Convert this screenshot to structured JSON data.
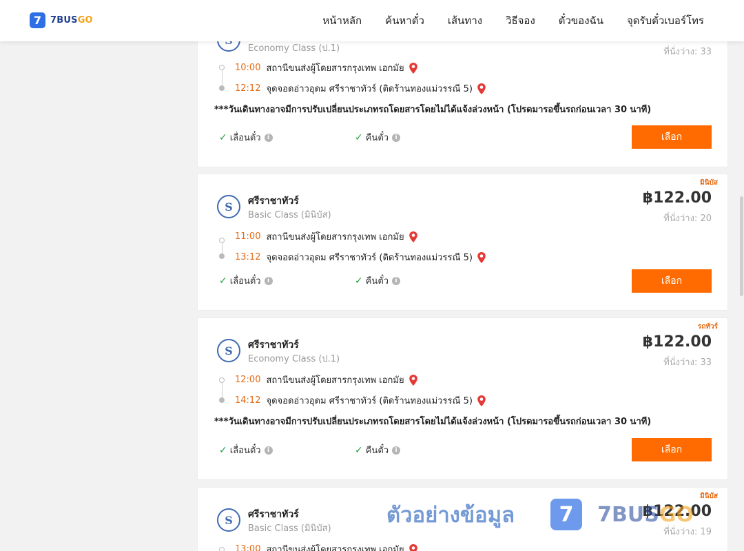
{
  "header": {
    "logo_mark": "7",
    "logo_brand": "7BUS",
    "logo_brand_go": "GO",
    "nav": [
      "หน้าหลัก",
      "ค้นหาตั๋ว",
      "เส้นทาง",
      "วิธีจอง",
      "ตั๋วของฉัน",
      "จุดรับตั๋วเบอร์โทร"
    ]
  },
  "common": {
    "reschedule": "เลื่อนตั๋ว",
    "refund": "คืนตั๋ว",
    "select": "เลือก",
    "notice": "***วันเดินทางอาจมีการปรับเปลี่ยนประเภทรถโดยสารโดยไม่ได้แจ้งล่วงหน้า (โปรดมารอขึ้นรถก่อนเวลา 30 นาที)",
    "origin": "สถานีขนส่งผู้โดยสารกรุงเทพ เอกมัย",
    "destination": "จุดจอดอ่าวอุดม ศรีราชาทัวร์ (ติดร้านทองแม่วรรณี 5)"
  },
  "trips": [
    {
      "class": "Economy Class (ป.1)",
      "seats": "ที่นั่งว่าง: 33",
      "depart": "10:00",
      "arrive": "12:12"
    },
    {
      "vehicle": "มินิบัส",
      "operator": "ศรีราชาทัวร์",
      "class": "Basic Class (มินิบัส)",
      "price": "฿122.00",
      "seats": "ที่นั่งว่าง: 20",
      "depart": "11:00",
      "arrive": "13:12"
    },
    {
      "vehicle": "รถทัวร์",
      "operator": "ศรีราชาทัวร์",
      "class": "Economy Class (ป.1)",
      "price": "฿122.00",
      "seats": "ที่นั่งว่าง: 33",
      "depart": "12:00",
      "arrive": "14:12"
    },
    {
      "vehicle": "มินิบัส",
      "operator": "ศรีราชาทัวร์",
      "class": "Basic Class (มินิบัส)",
      "price": "฿122.00",
      "seats": "ที่นั่งว่าง: 19",
      "depart": "13:00"
    }
  ],
  "watermark": {
    "text": "ตัวอย่างข้อมูล",
    "logo_mark": "7",
    "brand": "7BUS",
    "brand_go": "GO"
  },
  "colors": {
    "accent": "#ff6b00",
    "time": "#e46a12",
    "brand_blue": "#2f6fe6",
    "check": "#22a040"
  },
  "icons": [
    "map-pin-icon",
    "check-icon",
    "info-icon",
    "operator-logo-icon"
  ]
}
